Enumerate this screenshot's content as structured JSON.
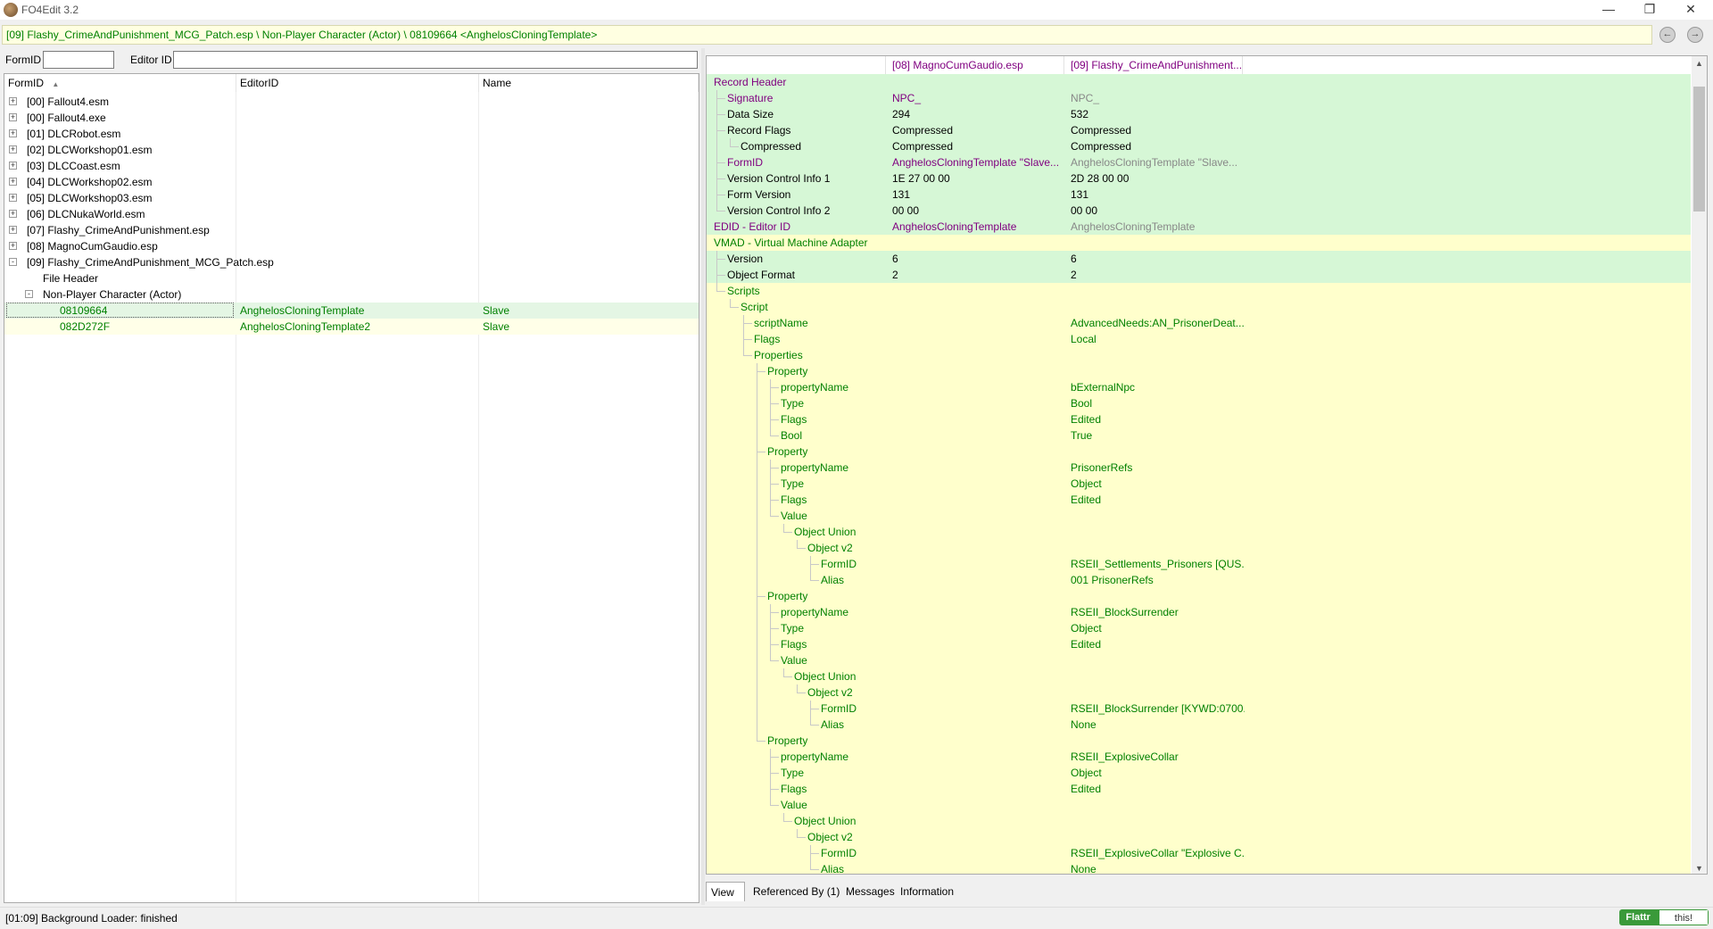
{
  "window": {
    "title": "FO4Edit 3.2"
  },
  "pathbar": {
    "text": "[09] Flashy_CrimeAndPunishment_MCG_Patch.esp \\ Non-Player Character (Actor) \\ 08109664 <AnghelosCloningTemplate>"
  },
  "filter": {
    "formid_label": "FormID",
    "editorid_label": "Editor ID",
    "formid_value": "",
    "editorid_value": ""
  },
  "left": {
    "columns": [
      "FormID",
      "EditorID",
      "Name"
    ],
    "tree": [
      {
        "label": "[00] Fallout4.esm",
        "level": 0,
        "exp": "+"
      },
      {
        "label": "[00] Fallout4.exe",
        "level": 0,
        "exp": "+"
      },
      {
        "label": "[01] DLCRobot.esm",
        "level": 0,
        "exp": "+"
      },
      {
        "label": "[02] DLCWorkshop01.esm",
        "level": 0,
        "exp": "+"
      },
      {
        "label": "[03] DLCCoast.esm",
        "level": 0,
        "exp": "+"
      },
      {
        "label": "[04] DLCWorkshop02.esm",
        "level": 0,
        "exp": "+"
      },
      {
        "label": "[05] DLCWorkshop03.esm",
        "level": 0,
        "exp": "+"
      },
      {
        "label": "[06] DLCNukaWorld.esm",
        "level": 0,
        "exp": "+"
      },
      {
        "label": "[07] Flashy_CrimeAndPunishment.esp",
        "level": 0,
        "exp": "+"
      },
      {
        "label": "[08] MagnoCumGaudio.esp",
        "level": 0,
        "exp": "+"
      },
      {
        "label": "[09] Flashy_CrimeAndPunishment_MCG_Patch.esp",
        "level": 0,
        "exp": "-"
      },
      {
        "label": "File Header",
        "level": 1,
        "exp": ""
      },
      {
        "label": "Non-Player Character (Actor)",
        "level": 1,
        "exp": "-"
      }
    ],
    "records": [
      {
        "formid": "08109664",
        "editorid": "AnghelosCloningTemplate",
        "name": "Slave",
        "selected": true
      },
      {
        "formid": "082D272F",
        "editorid": "AnghelosCloningTemplate2",
        "name": "Slave",
        "selected": false
      }
    ]
  },
  "right": {
    "headers": [
      "[08] MagnoCumGaudio.esp",
      "[09] Flashy_CrimeAndPunishment..."
    ],
    "rows": [
      {
        "label": "Record Header",
        "level": 0,
        "v1": "",
        "v2": "",
        "bg": "green"
      },
      {
        "label": "Signature",
        "level": 1,
        "v1": "NPC_",
        "v2": "NPC_",
        "bg": "green",
        "lc": "#800080",
        "c1": "#800080",
        "c2": "#888888"
      },
      {
        "label": "Data Size",
        "level": 1,
        "v1": "294",
        "v2": "532",
        "bg": "green",
        "lc": "#000",
        "c1": "#000",
        "c2": "#000"
      },
      {
        "label": "Record Flags",
        "level": 1,
        "v1": "Compressed",
        "v2": "Compressed",
        "bg": "green",
        "lc": "#000",
        "c1": "#000",
        "c2": "#000"
      },
      {
        "label": "Compressed",
        "level": 2,
        "v1": "Compressed",
        "v2": "Compressed",
        "bg": "green",
        "lc": "#000",
        "c1": "#000",
        "c2": "#000"
      },
      {
        "label": "FormID",
        "level": 1,
        "v1": "AnghelosCloningTemplate \"Slave...",
        "v2": "AnghelosCloningTemplate \"Slave...",
        "bg": "green",
        "lc": "#800080",
        "c1": "#800080",
        "c2": "#888888"
      },
      {
        "label": "Version Control Info 1",
        "level": 1,
        "v1": "1E 27 00 00",
        "v2": "2D 28 00 00",
        "bg": "green",
        "lc": "#000",
        "c1": "#000",
        "c2": "#000"
      },
      {
        "label": "Form Version",
        "level": 1,
        "v1": "131",
        "v2": "131",
        "bg": "green",
        "lc": "#000",
        "c1": "#000",
        "c2": "#000"
      },
      {
        "label": "Version Control Info 2",
        "level": 1,
        "v1": "00 00",
        "v2": "00 00",
        "bg": "green",
        "lc": "#000",
        "c1": "#000",
        "c2": "#000"
      },
      {
        "label": "EDID - Editor ID",
        "level": 0,
        "v1": "AnghelosCloningTemplate",
        "v2": "AnghelosCloningTemplate",
        "bg": "green",
        "lc": "#800080",
        "c1": "#800080",
        "c2": "#888888"
      },
      {
        "label": "VMAD - Virtual Machine Adapter",
        "level": 0,
        "v1": "",
        "v2": "",
        "bg": "yellow",
        "lc": "#008000"
      },
      {
        "label": "Version",
        "level": 1,
        "v1": "6",
        "v2": "6",
        "bg": "green",
        "lc": "#000",
        "c1": "#000",
        "c2": "#000"
      },
      {
        "label": "Object Format",
        "level": 1,
        "v1": "2",
        "v2": "2",
        "bg": "green",
        "lc": "#000",
        "c1": "#000",
        "c2": "#000"
      },
      {
        "label": "Scripts",
        "level": 1,
        "v1": "",
        "v2": "",
        "bg": "yellow",
        "lc": "#008000"
      },
      {
        "label": "Script",
        "level": 2,
        "v1": "",
        "v2": "",
        "bg": "yellow",
        "lc": "#008000"
      },
      {
        "label": "scriptName",
        "level": 3,
        "v1": "",
        "v2": "AdvancedNeeds:AN_PrisonerDeat...",
        "bg": "yellow",
        "lc": "#008000",
        "c2": "#008000"
      },
      {
        "label": "Flags",
        "level": 3,
        "v1": "",
        "v2": "Local",
        "bg": "yellow",
        "lc": "#008000",
        "c2": "#008000"
      },
      {
        "label": "Properties",
        "level": 3,
        "v1": "",
        "v2": "",
        "bg": "yellow",
        "lc": "#008000"
      },
      {
        "label": "Property",
        "level": 4,
        "v1": "",
        "v2": "",
        "bg": "yellow",
        "lc": "#008000"
      },
      {
        "label": "propertyName",
        "level": 5,
        "v1": "",
        "v2": "bExternalNpc",
        "bg": "yellow",
        "lc": "#008000",
        "c2": "#008000"
      },
      {
        "label": "Type",
        "level": 5,
        "v1": "",
        "v2": "Bool",
        "bg": "yellow",
        "lc": "#008000",
        "c2": "#008000"
      },
      {
        "label": "Flags",
        "level": 5,
        "v1": "",
        "v2": "Edited",
        "bg": "yellow",
        "lc": "#008000",
        "c2": "#008000"
      },
      {
        "label": "Bool",
        "level": 5,
        "v1": "",
        "v2": "True",
        "bg": "yellow",
        "lc": "#008000",
        "c2": "#008000"
      },
      {
        "label": "Property",
        "level": 4,
        "v1": "",
        "v2": "",
        "bg": "yellow",
        "lc": "#008000"
      },
      {
        "label": "propertyName",
        "level": 5,
        "v1": "",
        "v2": "PrisonerRefs",
        "bg": "yellow",
        "lc": "#008000",
        "c2": "#008000"
      },
      {
        "label": "Type",
        "level": 5,
        "v1": "",
        "v2": "Object",
        "bg": "yellow",
        "lc": "#008000",
        "c2": "#008000"
      },
      {
        "label": "Flags",
        "level": 5,
        "v1": "",
        "v2": "Edited",
        "bg": "yellow",
        "lc": "#008000",
        "c2": "#008000"
      },
      {
        "label": "Value",
        "level": 5,
        "v1": "",
        "v2": "",
        "bg": "yellow",
        "lc": "#008000"
      },
      {
        "label": "Object Union",
        "level": 6,
        "v1": "",
        "v2": "",
        "bg": "yellow",
        "lc": "#008000"
      },
      {
        "label": "Object v2",
        "level": 7,
        "v1": "",
        "v2": "",
        "bg": "yellow",
        "lc": "#008000"
      },
      {
        "label": "FormID",
        "level": 8,
        "v1": "",
        "v2": "RSEII_Settlements_Prisoners [QUS...",
        "bg": "yellow",
        "lc": "#008000",
        "c2": "#008000"
      },
      {
        "label": "Alias",
        "level": 8,
        "v1": "",
        "v2": "001 PrisonerRefs",
        "bg": "yellow",
        "lc": "#008000",
        "c2": "#008000"
      },
      {
        "label": "Property",
        "level": 4,
        "v1": "",
        "v2": "",
        "bg": "yellow",
        "lc": "#008000"
      },
      {
        "label": "propertyName",
        "level": 5,
        "v1": "",
        "v2": "RSEII_BlockSurrender",
        "bg": "yellow",
        "lc": "#008000",
        "c2": "#008000"
      },
      {
        "label": "Type",
        "level": 5,
        "v1": "",
        "v2": "Object",
        "bg": "yellow",
        "lc": "#008000",
        "c2": "#008000"
      },
      {
        "label": "Flags",
        "level": 5,
        "v1": "",
        "v2": "Edited",
        "bg": "yellow",
        "lc": "#008000",
        "c2": "#008000"
      },
      {
        "label": "Value",
        "level": 5,
        "v1": "",
        "v2": "",
        "bg": "yellow",
        "lc": "#008000"
      },
      {
        "label": "Object Union",
        "level": 6,
        "v1": "",
        "v2": "",
        "bg": "yellow",
        "lc": "#008000"
      },
      {
        "label": "Object v2",
        "level": 7,
        "v1": "",
        "v2": "",
        "bg": "yellow",
        "lc": "#008000"
      },
      {
        "label": "FormID",
        "level": 8,
        "v1": "",
        "v2": "RSEII_BlockSurrender [KYWD:0700...",
        "bg": "yellow",
        "lc": "#008000",
        "c2": "#008000"
      },
      {
        "label": "Alias",
        "level": 8,
        "v1": "",
        "v2": "None",
        "bg": "yellow",
        "lc": "#008000",
        "c2": "#008000"
      },
      {
        "label": "Property",
        "level": 4,
        "v1": "",
        "v2": "",
        "bg": "yellow",
        "lc": "#008000"
      },
      {
        "label": "propertyName",
        "level": 5,
        "v1": "",
        "v2": "RSEII_ExplosiveCollar",
        "bg": "yellow",
        "lc": "#008000",
        "c2": "#008000"
      },
      {
        "label": "Type",
        "level": 5,
        "v1": "",
        "v2": "Object",
        "bg": "yellow",
        "lc": "#008000",
        "c2": "#008000"
      },
      {
        "label": "Flags",
        "level": 5,
        "v1": "",
        "v2": "Edited",
        "bg": "yellow",
        "lc": "#008000",
        "c2": "#008000"
      },
      {
        "label": "Value",
        "level": 5,
        "v1": "",
        "v2": "",
        "bg": "yellow",
        "lc": "#008000"
      },
      {
        "label": "Object Union",
        "level": 6,
        "v1": "",
        "v2": "",
        "bg": "yellow",
        "lc": "#008000"
      },
      {
        "label": "Object v2",
        "level": 7,
        "v1": "",
        "v2": "",
        "bg": "yellow",
        "lc": "#008000"
      },
      {
        "label": "FormID",
        "level": 8,
        "v1": "",
        "v2": "RSEII_ExplosiveCollar \"Explosive C...",
        "bg": "yellow",
        "lc": "#008000",
        "c2": "#008000"
      },
      {
        "label": "Alias",
        "level": 8,
        "v1": "",
        "v2": "None",
        "bg": "yellow",
        "lc": "#008000",
        "c2": "#008000"
      }
    ]
  },
  "tabs": [
    {
      "label": "View",
      "active": true
    },
    {
      "label": "Referenced By (1)",
      "active": false
    },
    {
      "label": "Messages",
      "active": false
    },
    {
      "label": "Information",
      "active": false
    }
  ],
  "status": {
    "text": "[01:09] Background Loader: finished"
  },
  "flattr": {
    "left": "Flattr",
    "right": "this!"
  },
  "colors": {
    "record_purple": "#800080",
    "edited_green": "#008000",
    "conflict_bg": "#d6f7d6",
    "override_bg": "#ffffcc"
  }
}
